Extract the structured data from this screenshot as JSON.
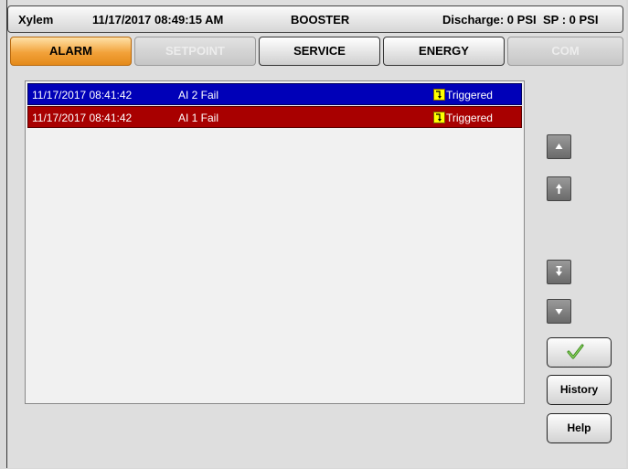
{
  "header": {
    "brand": "Xylem",
    "datetime": "11/17/2017 08:49:15 AM",
    "mode": "BOOSTER",
    "discharge": "Discharge: 0 PSI",
    "setpoint": "SP : 0 PSI"
  },
  "tabs": [
    {
      "label": "ALARM",
      "state": "active"
    },
    {
      "label": "SETPOINT",
      "state": "disabled"
    },
    {
      "label": "SERVICE",
      "state": "normal"
    },
    {
      "label": "ENERGY",
      "state": "normal"
    },
    {
      "label": "COM",
      "state": "disabled"
    }
  ],
  "alarms": [
    {
      "timestamp": "11/17/2017 08:41:42",
      "description": "AI 2 Fail",
      "status": "Triggered",
      "status_icon": "triggered-icon",
      "color": "#0000b8"
    },
    {
      "timestamp": "11/17/2017 08:41:42",
      "description": "AI 1 Fail",
      "status": "Triggered",
      "status_icon": "triggered-icon",
      "color": "#a80000"
    }
  ],
  "side_buttons": {
    "acknowledge_icon": "checkmark-icon",
    "history_label": "History",
    "help_label": "Help"
  },
  "colors": {
    "active_tab": "#f2a23a",
    "alarm_blue": "#0000b8",
    "alarm_red": "#a80000",
    "status_icon": "#ffff00"
  }
}
